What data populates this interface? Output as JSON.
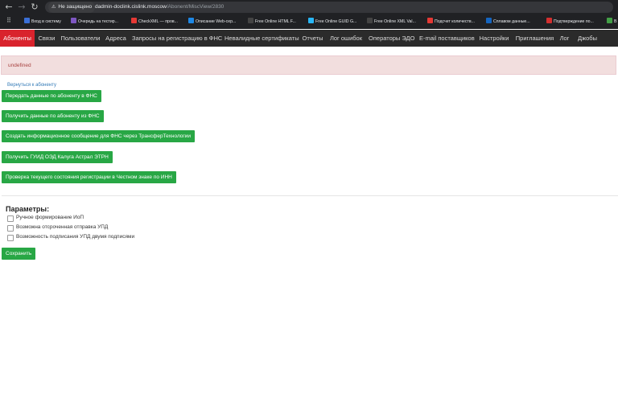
{
  "browser": {
    "security_label": "Не защищено",
    "url_host": "dadmin-doclink.cislink.moscow",
    "url_path": "/Abonent/MiscView/2830",
    "bookmarks": [
      {
        "label": "Вход в систему",
        "color": "#3b6fd6"
      },
      {
        "label": "Очередь на тестир...",
        "color": "#7e57c2"
      },
      {
        "label": "CheckXML — пров...",
        "color": "#e53935"
      },
      {
        "label": "Описание Web-сер...",
        "color": "#1e88e5"
      },
      {
        "label": "Free Online HTML F...",
        "color": "#444444"
      },
      {
        "label": "Free Online GUID G...",
        "color": "#29b6f6"
      },
      {
        "label": "Free Online XML Val...",
        "color": "#444444"
      },
      {
        "label": "Подсчет количеств...",
        "color": "#e53935"
      },
      {
        "label": "Сплавом данные...",
        "color": "#1565c0"
      },
      {
        "label": "Подтверждение по...",
        "color": "#d32f2f"
      },
      {
        "label": "В",
        "color": "#43a047"
      }
    ]
  },
  "nav": {
    "items": [
      "Абоненты",
      "Связи",
      "Пользователи",
      "Адреса",
      "Запросы на регистрацию в ФНС",
      "Невалидные сертификаты",
      "Отчеты",
      "Лог ошибок",
      "Операторы ЭДО",
      "E-mail поставщиков",
      "Настройки",
      "Приглашения",
      "Лог",
      "Джобы"
    ],
    "active": "Абоненты"
  },
  "alert": {
    "text": "undefined"
  },
  "back_link": "Вернуться к абоненту",
  "actions": [
    "Передать данные по абоненту в ФНС",
    "Получить данные по абоненту из ФНС",
    "Создать информационное сообщение для ФНС через ТрансферТехнологии",
    "Получить ГУИД ОЭД Калуга Астрал ЭТРН",
    "Проверка текущего состояния регистрации в Честном знаке по ИНН"
  ],
  "params": {
    "title": "Параметры:",
    "options": [
      {
        "label": "Ручное формирование ИоП",
        "checked": false
      },
      {
        "label": "Возможна отсроченная отправка УПД",
        "checked": false
      },
      {
        "label": "Возможность подписания УПД двумя подписями",
        "checked": false
      }
    ],
    "save_label": "Сохранить"
  }
}
